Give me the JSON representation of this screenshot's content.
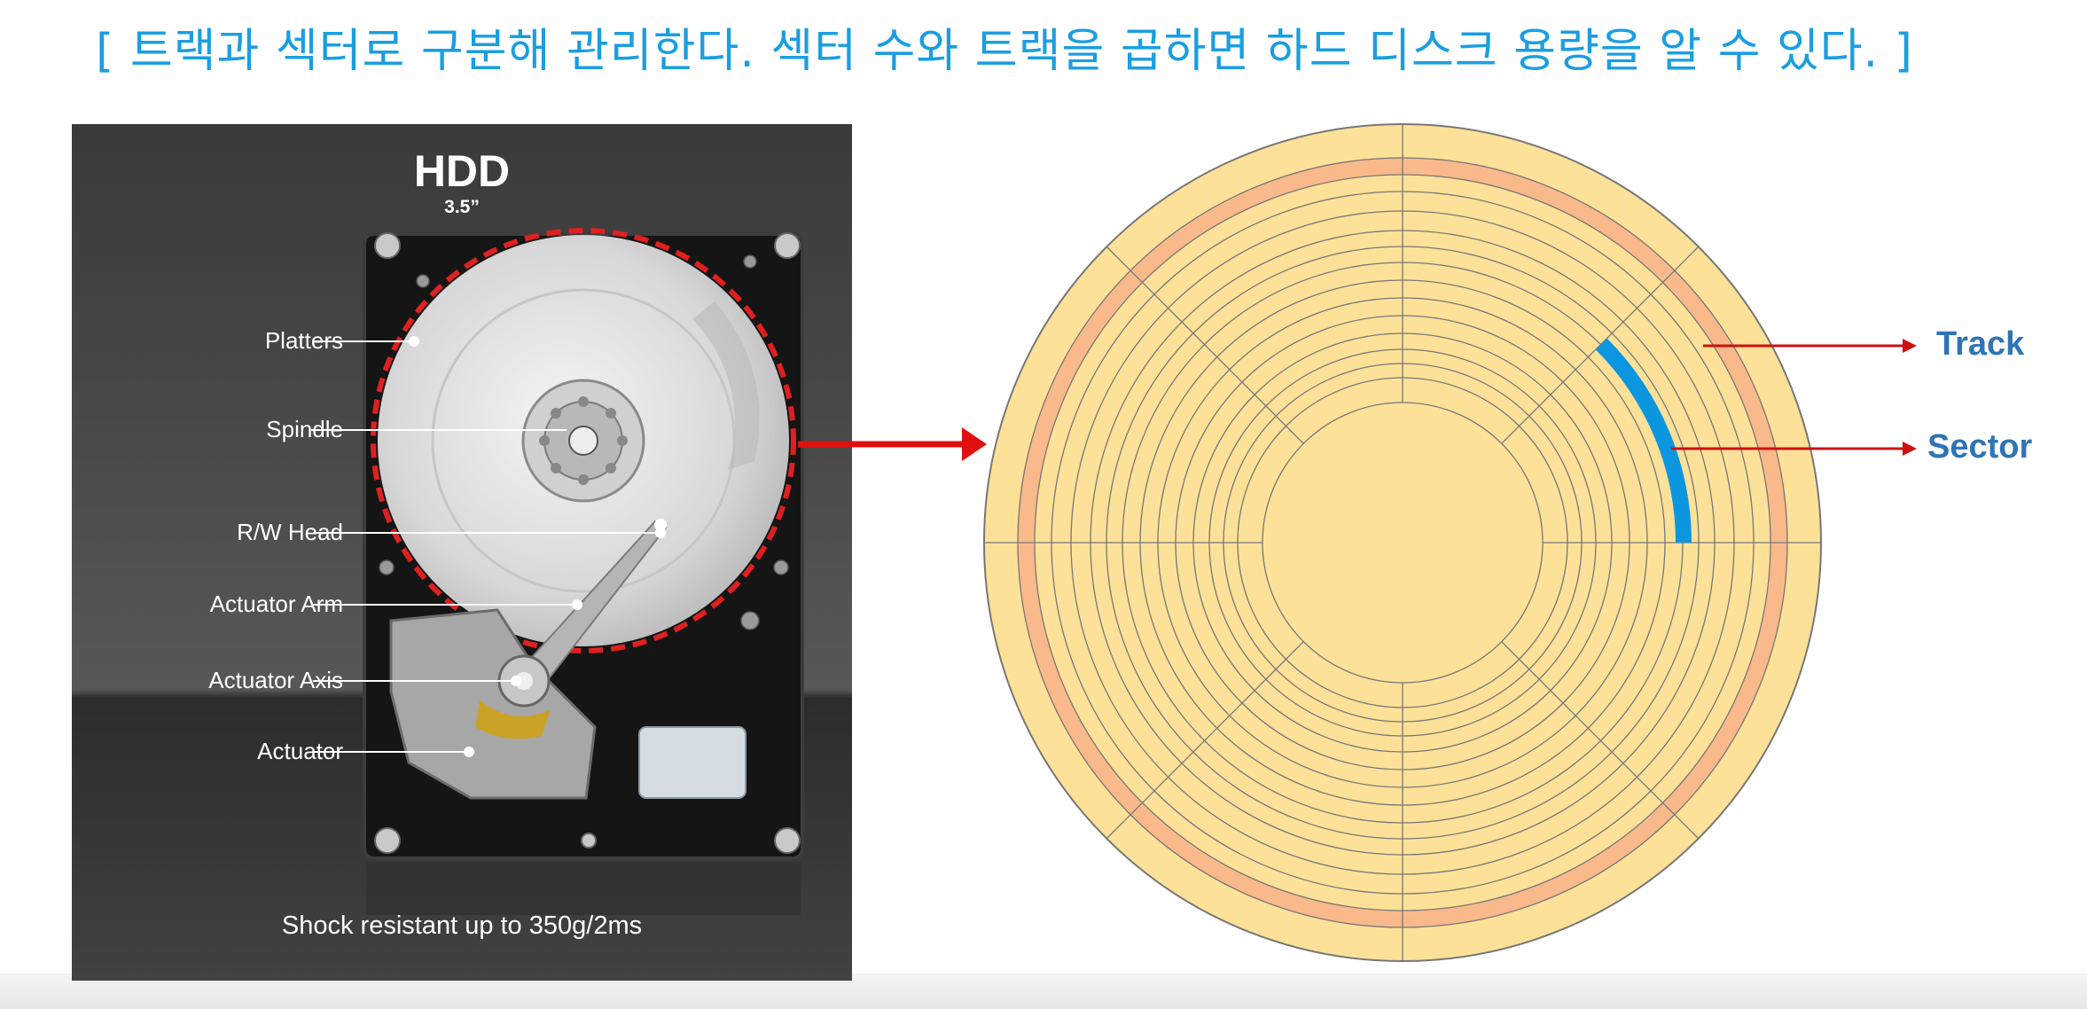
{
  "headline": "[ 트랙과 섹터로 구분해 관리한다. 섹터 수와 트랙을 곱하면 하드 디스크 용량을 알 수 있다. ]",
  "photo": {
    "title": "HDD",
    "size": "3.5”",
    "labels": {
      "platters": "Platters",
      "spindle": "Spindle",
      "rw_head": "R/W Head",
      "actuator_arm": "Actuator Arm",
      "actuator_axis": "Actuator Axis",
      "actuator": "Actuator"
    },
    "footnote": "Shock resistant up to 350g/2ms"
  },
  "disk": {
    "track_label": "Track",
    "sector_label": "Sector",
    "colors": {
      "platter_fill": "#fde198",
      "highlight_track": "#f9b98a",
      "highlight_sector": "#0d96e0",
      "grid_line": "#777777",
      "arrow": "#cc1111",
      "label": "#2f74b5"
    }
  }
}
